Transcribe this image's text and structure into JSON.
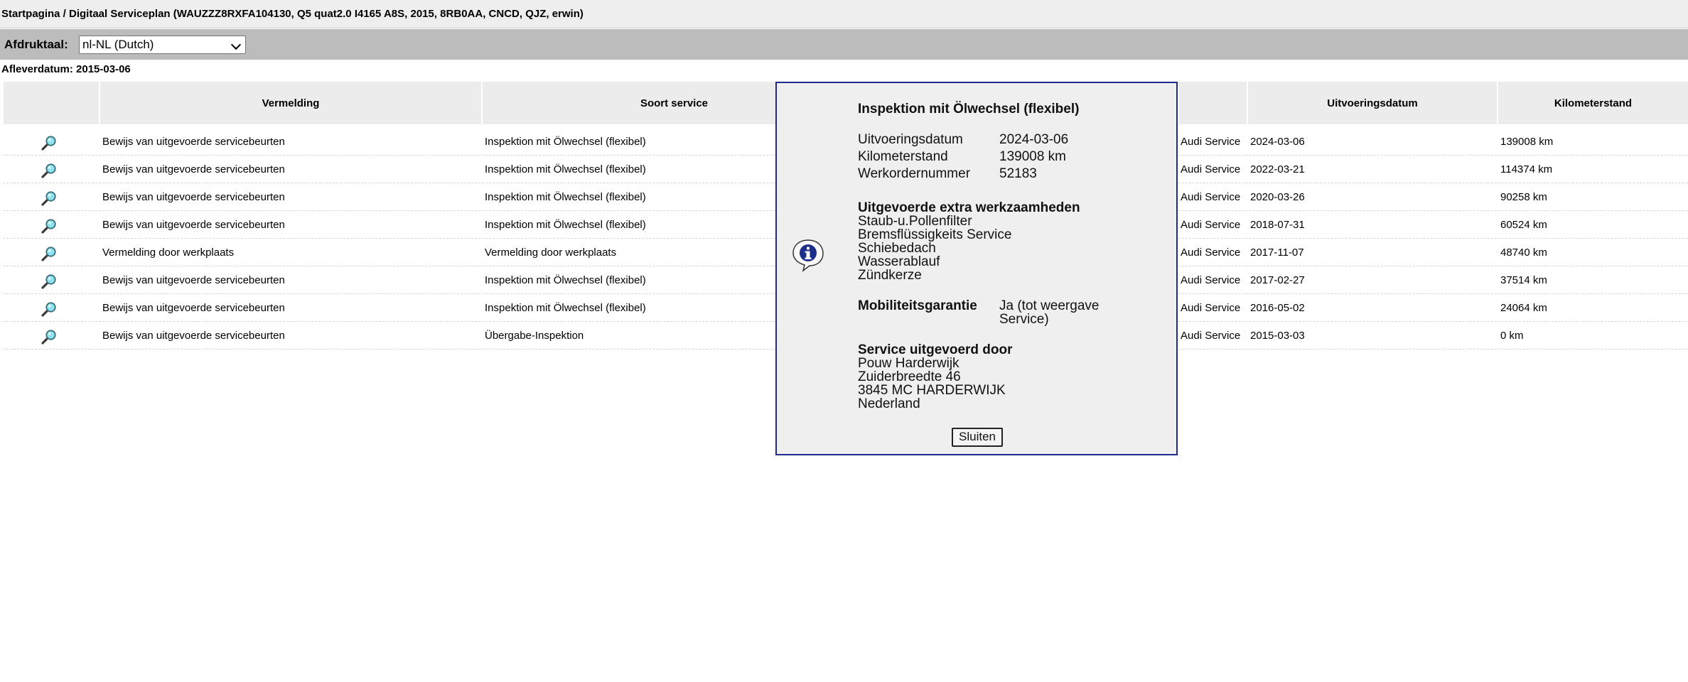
{
  "breadcrumb": "Startpagina / Digitaal Serviceplan (WAUZZZ8RXFA104130, Q5 quat2.0 I4165 A8S, 2015, 8RB0AA, CNCD, QJZ, erwin)",
  "print_language": {
    "label": "Afdruktaal:",
    "selected": "nl-NL (Dutch)"
  },
  "delivery_date": "Afleverdatum: 2015-03-06",
  "table": {
    "headers": {
      "vermelding": "Vermelding",
      "soort_service": "Soort service",
      "uitvoeringsdatum": "Uitvoeringsdatum",
      "kilometerstand": "Kilometerstand"
    },
    "rows": [
      {
        "vermelding": "Bewijs van uitgevoerde servicebeurten",
        "soort": "Inspektion mit Ölwechsel (flexibel)",
        "partner": "Audi Service",
        "datum": "2024-03-06",
        "km": "139008 km"
      },
      {
        "vermelding": "Bewijs van uitgevoerde servicebeurten",
        "soort": "Inspektion mit Ölwechsel (flexibel)",
        "partner": "Audi Service",
        "datum": "2022-03-21",
        "km": "114374 km"
      },
      {
        "vermelding": "Bewijs van uitgevoerde servicebeurten",
        "soort": "Inspektion mit Ölwechsel (flexibel)",
        "partner": "Audi Service",
        "datum": "2020-03-26",
        "km": "90258 km"
      },
      {
        "vermelding": "Bewijs van uitgevoerde servicebeurten",
        "soort": "Inspektion mit Ölwechsel (flexibel)",
        "partner": "Audi Service",
        "datum": "2018-07-31",
        "km": "60524 km"
      },
      {
        "vermelding": "Vermelding door werkplaats",
        "soort": "Vermelding door werkplaats",
        "partner": "Audi Service",
        "datum": "2017-11-07",
        "km": "48740 km"
      },
      {
        "vermelding": "Bewijs van uitgevoerde servicebeurten",
        "soort": "Inspektion mit Ölwechsel (flexibel)",
        "partner": "Audi Service",
        "datum": "2017-02-27",
        "km": "37514 km"
      },
      {
        "vermelding": "Bewijs van uitgevoerde servicebeurten",
        "soort": "Inspektion mit Ölwechsel (flexibel)",
        "partner": "Audi Service",
        "datum": "2016-05-02",
        "km": "24064 km"
      },
      {
        "vermelding": "Bewijs van uitgevoerde servicebeurten",
        "soort": "Übergabe-Inspektion",
        "partner": "Audi Service",
        "datum": "2015-03-03",
        "km": "0 km"
      }
    ]
  },
  "dialog": {
    "title": "Inspektion mit Ölwechsel (flexibel)",
    "fields": [
      {
        "label": "Uitvoeringsdatum",
        "value": "2024-03-06"
      },
      {
        "label": "Kilometerstand",
        "value": "139008 km"
      },
      {
        "label": "Werkordernummer",
        "value": "52183"
      }
    ],
    "extra_heading": "Uitgevoerde extra werkzaamheden",
    "extra_items": [
      "Staub-u.Pollenfilter",
      "Bremsflüssigkeits Service",
      "Schiebedach",
      "Wasserablauf",
      "Zündkerze"
    ],
    "mobility_label": "Mobiliteitsgarantie",
    "mobility_value_line1": "Ja (tot weergave",
    "mobility_value_line2": "Service)",
    "performed_heading": "Service uitgevoerd door",
    "performed_by": [
      "Pouw Harderwijk",
      "Zuiderbreedte 46",
      "3845 MC HARDERWIJK",
      "Nederland"
    ],
    "close_label": "Sluiten"
  },
  "colors": {
    "dialog_border": "#1f2a8c",
    "info_icon_blue": "#1b2f8a",
    "magnifier_lens": "#8fe3f0"
  }
}
